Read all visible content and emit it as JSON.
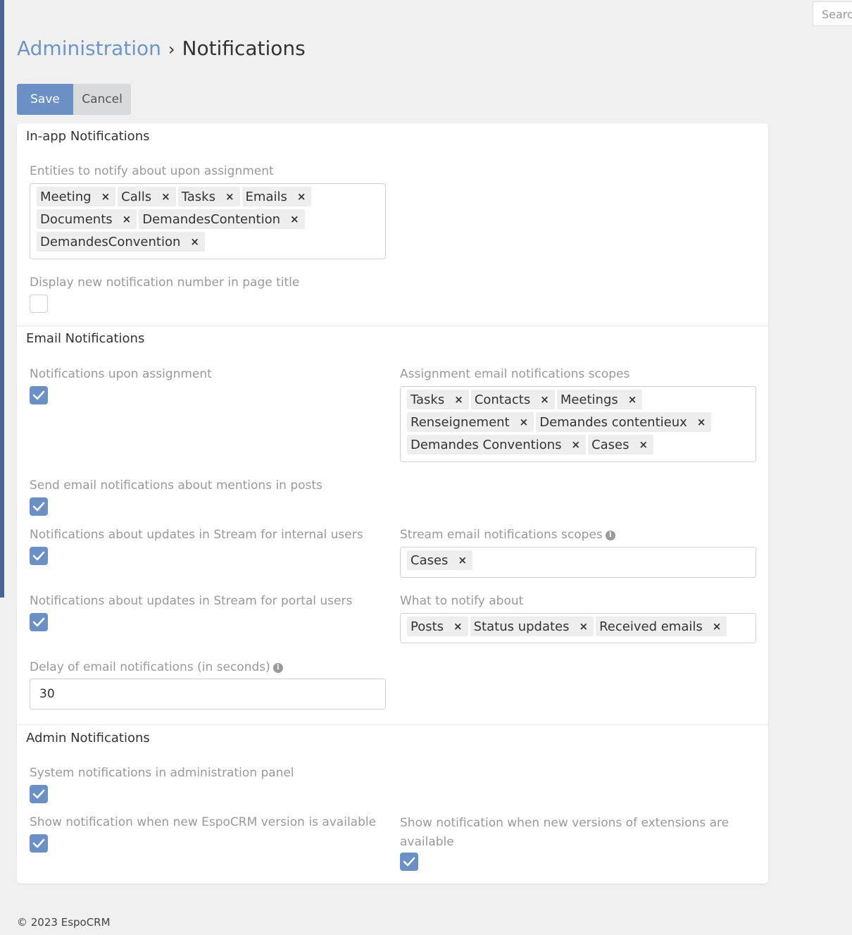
{
  "header": {
    "search_placeholder": "Search",
    "breadcrumb": {
      "parent": "Administration",
      "separator": "›",
      "current": "Notifications"
    }
  },
  "buttons": {
    "save": "Save",
    "cancel": "Cancel"
  },
  "in_app": {
    "title": "In-app Notifications",
    "entities_label": "Entities to notify about upon assignment",
    "entities": [
      "Meeting",
      "Calls",
      "Tasks",
      "Emails",
      "Documents",
      "DemandesContention",
      "DemandesConvention"
    ],
    "display_number_label": "Display new notification number in page title",
    "display_number_checked": false
  },
  "email": {
    "title": "Email Notifications",
    "upon_assignment_label": "Notifications upon assignment",
    "upon_assignment_checked": true,
    "assignment_scopes_label": "Assignment email notifications scopes",
    "assignment_scopes": [
      "Tasks",
      "Contacts",
      "Meetings",
      "Renseignement",
      "Demandes contentieux",
      "Demandes Conventions",
      "Cases"
    ],
    "mentions_label": "Send email notifications about mentions in posts",
    "mentions_checked": true,
    "stream_internal_label": "Notifications about updates in Stream for internal users",
    "stream_internal_checked": true,
    "stream_scopes_label": "Stream email notifications scopes",
    "stream_scopes": [
      "Cases"
    ],
    "stream_portal_label": "Notifications about updates in Stream for portal users",
    "stream_portal_checked": true,
    "what_label": "What to notify about",
    "what_items": [
      "Posts",
      "Status updates",
      "Received emails"
    ],
    "delay_label": "Delay of email notifications (in seconds)",
    "delay_value": "30",
    "info_glyph": "i"
  },
  "admin": {
    "title": "Admin Notifications",
    "system_label": "System notifications in administration panel",
    "system_checked": true,
    "new_version_label": "Show notification when new EspoCRM version is available",
    "new_version_checked": true,
    "extensions_label": "Show notification when new versions of extensions are available",
    "extensions_checked": true
  },
  "tag_remove_glyph": "×",
  "footer": {
    "text": "© 2023 EspoCRM"
  },
  "colors": {
    "accent": "#6a90c5",
    "link": "#6d95c6",
    "sidebar_strip": "#4a6492"
  }
}
